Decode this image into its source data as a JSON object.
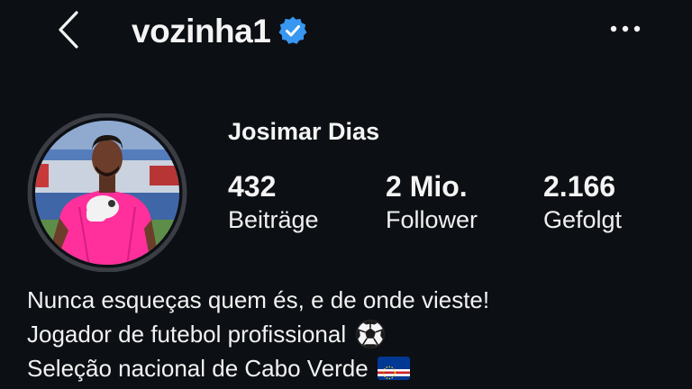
{
  "header": {
    "username": "vozinha1",
    "back_icon": "chevron-left-icon",
    "verified_icon": "verified-badge-icon",
    "more_icon": "more-horizontal-icon"
  },
  "profile": {
    "display_name": "Josimar Dias",
    "stats": [
      {
        "value": "432",
        "label": "Beiträge"
      },
      {
        "value": "2 Mio.",
        "label": "Follower"
      },
      {
        "value": "2.166",
        "label": "Gefolgt"
      }
    ]
  },
  "bio": {
    "line1": "Nunca esqueças quem és, e de onde vieste!",
    "line2": "Jogador de futebol profissional",
    "line2_emoji": "soccer-ball-icon",
    "line3": "Seleção nacional de Cabo Verde",
    "line3_emoji": "cape-verde-flag-icon"
  },
  "colors": {
    "background": "#0c0f14",
    "text": "#f4f4f4",
    "verified_blue": "#3897f0",
    "avatar_ring": "#3a3d44",
    "jersey_pink": "#ff2f9b"
  }
}
